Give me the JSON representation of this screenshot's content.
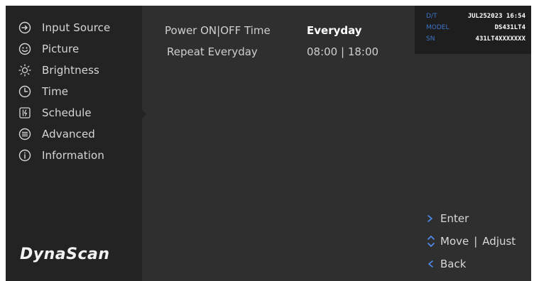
{
  "brand": {
    "logo_text": "DynaScan"
  },
  "menu": {
    "items": [
      {
        "label": "Input Source",
        "icon": "input-source-icon"
      },
      {
        "label": "Picture",
        "icon": "picture-icon"
      },
      {
        "label": "Brightness",
        "icon": "brightness-icon"
      },
      {
        "label": "Time",
        "icon": "clock-icon"
      },
      {
        "label": "Schedule",
        "icon": "schedule-icon"
      },
      {
        "label": "Advanced",
        "icon": "advanced-icon"
      },
      {
        "label": "Information",
        "icon": "information-icon"
      }
    ],
    "selected": "Schedule"
  },
  "settings": {
    "rows": [
      {
        "label": "Power ON|OFF Time",
        "value": "Everyday",
        "active": true
      },
      {
        "label": "Repeat Everyday",
        "value": "08:00 | 18:00",
        "active": false
      }
    ]
  },
  "info": {
    "dt_key": "D/T",
    "dt_value": "JUL252023 16:54",
    "model_key": "MODEL",
    "model_value": "DS431LT4",
    "sn_key": "SN",
    "sn_value": "431LT4XXXXXXX"
  },
  "hints": {
    "enter": "Enter",
    "move": "Move",
    "separator": "|",
    "adjust": "Adjust",
    "back": "Back"
  },
  "colors": {
    "accent": "#4f8ff0",
    "info_key": "#3f74c9",
    "sidebar_bg": "#232323",
    "content_bg": "#2f2f2f"
  }
}
